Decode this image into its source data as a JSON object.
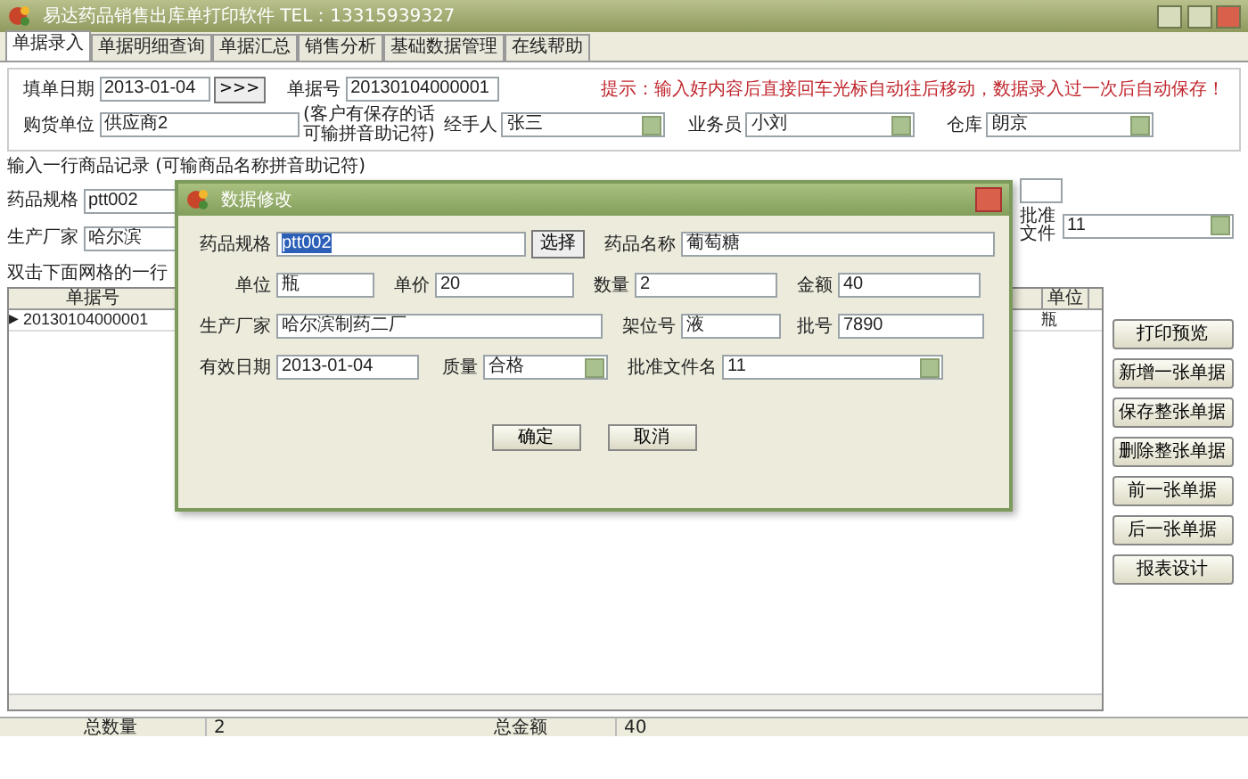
{
  "window": {
    "title": "易达药品销售出库单打印软件  TEL：13315939327"
  },
  "tabs": [
    {
      "label": "单据录入",
      "selected": true
    },
    {
      "label": "单据明细查询",
      "selected": false
    },
    {
      "label": "单据汇总",
      "selected": false
    },
    {
      "label": "销售分析",
      "selected": false
    },
    {
      "label": "基础数据管理",
      "selected": false
    },
    {
      "label": "在线帮助",
      "selected": false
    }
  ],
  "header_form": {
    "date": {
      "label": "填单日期",
      "value": "2013-01-04",
      "button": ">>>"
    },
    "order_no": {
      "label": "单据号",
      "value": "20130104000001"
    },
    "hint": "提示：输入好内容后直接回车光标自动往后移动，数据录入过一次后自动保存！",
    "buyer": {
      "label": "购货单位",
      "value": "供应商2",
      "note": [
        "(客户有保存的话",
        "可输拼音助记符)"
      ]
    },
    "handler": {
      "label": "经手人",
      "value": "张三"
    },
    "salesperson": {
      "label": "业务员",
      "value": "小刘"
    },
    "warehouse": {
      "label": "仓库",
      "value": "朗京"
    }
  },
  "item_entry": {
    "title": "输入一行商品记录 (可输商品名称拼音助记符)",
    "spec": {
      "label": "药品规格",
      "value": "ptt002"
    },
    "maker": {
      "label": "生产厂家",
      "value": "哈尔滨"
    },
    "approval": {
      "label": "批准文件",
      "value": "11"
    }
  },
  "grid": {
    "caption": "双击下面网格的一行",
    "pointer": "▶",
    "columns": [
      "单据号",
      "单位"
    ],
    "rows": [
      {
        "cells": [
          "20130104000001",
          "瓶"
        ],
        "selected": true
      }
    ]
  },
  "side_buttons": [
    "打印预览",
    "新增一张单据",
    "保存整张单据",
    "删除整张单据",
    "前一张单据",
    "后一张单据",
    "报表设计"
  ],
  "totals": [
    {
      "label": "总数量",
      "value": "2"
    },
    {
      "label": "总金额",
      "value": "40"
    }
  ],
  "dialog": {
    "title": "数据修改",
    "spec": {
      "label": "药品规格",
      "value": "ptt002",
      "highlighted": true
    },
    "choose_button": "选择",
    "drug_name": {
      "label": "药品名称",
      "value": "葡萄糖",
      "highlighted": false
    },
    "unit": {
      "label": "单位",
      "value": "瓶",
      "highlighted": false
    },
    "price": {
      "label": "单价",
      "value": "20",
      "highlighted": false
    },
    "quantity": {
      "label": "数量",
      "value": "2",
      "highlighted": false
    },
    "amount": {
      "label": "金额",
      "value": "40",
      "highlighted": false
    },
    "maker": {
      "label": "生产厂家",
      "value": "哈尔滨制药二厂",
      "highlighted": false
    },
    "shelf": {
      "label": "架位号",
      "value": "液",
      "highlighted": false
    },
    "batch": {
      "label": "批号",
      "value": "7890",
      "highlighted": false
    },
    "expiry": {
      "label": "有效日期",
      "value": "2013-01-04",
      "highlighted": false
    },
    "quality": {
      "label": "质量",
      "value": "合格"
    },
    "approval_doc": {
      "label": "批准文件名",
      "value": "11"
    },
    "buttons": [
      "确定",
      "取消"
    ]
  }
}
